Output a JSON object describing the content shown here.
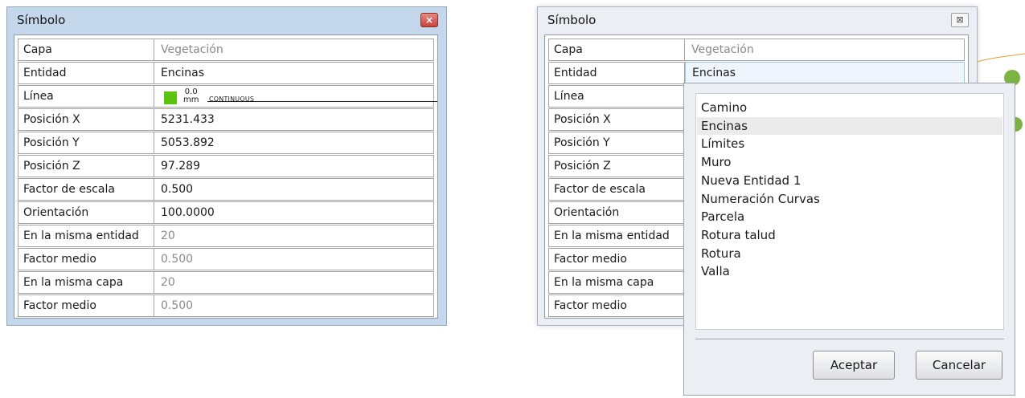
{
  "left_panel": {
    "title": "Símbolo",
    "close_glyph": "×",
    "rows": [
      {
        "label": "Capa",
        "value": "Vegetación"
      },
      {
        "label": "Entidad",
        "value": "Encinas"
      },
      {
        "label": "Línea",
        "value": ""
      },
      {
        "label": "Posición X",
        "value": "5231.433"
      },
      {
        "label": "Posición Y",
        "value": "5053.892"
      },
      {
        "label": "Posición Z",
        "value": "97.289"
      },
      {
        "label": "Factor de escala",
        "value": "0.500"
      },
      {
        "label": "Orientación",
        "value": "100.0000"
      },
      {
        "label": "En la misma entidad",
        "value": "20"
      },
      {
        "label": "Factor medio",
        "value": "0.500"
      },
      {
        "label": "En la misma capa",
        "value": "20"
      },
      {
        "label": "Factor medio",
        "value": "0.500"
      }
    ],
    "line": {
      "width_value": "0.0",
      "width_unit": "mm",
      "type": "CONTINUOUS",
      "color": "#5ac30f"
    }
  },
  "right_panel": {
    "title": "Símbolo",
    "close_glyph": "⊠",
    "rows": [
      {
        "label": "Capa",
        "value": "Vegetación"
      },
      {
        "label": "Entidad",
        "value": "Encinas"
      },
      {
        "label": "Línea"
      },
      {
        "label": "Posición X"
      },
      {
        "label": "Posición Y"
      },
      {
        "label": "Posición Z"
      },
      {
        "label": "Factor de escala"
      },
      {
        "label": "Orientación"
      },
      {
        "label": "En la misma entidad"
      },
      {
        "label": "Factor medio"
      },
      {
        "label": "En la misma capa"
      },
      {
        "label": "Factor medio"
      }
    ]
  },
  "dropdown": {
    "options": [
      "Camino",
      "Encinas",
      "Límites",
      "Muro",
      "Nueva Entidad 1",
      "Numeración Curvas",
      "Parcela",
      "Rotura talud",
      "Rotura",
      "Valla"
    ],
    "selected": "Encinas",
    "accept_label": "Aceptar",
    "cancel_label": "Cancelar"
  },
  "colors": {
    "accent_green": "#5ac30f",
    "tree_green": "#7cb342",
    "contour_orange": "#e69a2e"
  }
}
